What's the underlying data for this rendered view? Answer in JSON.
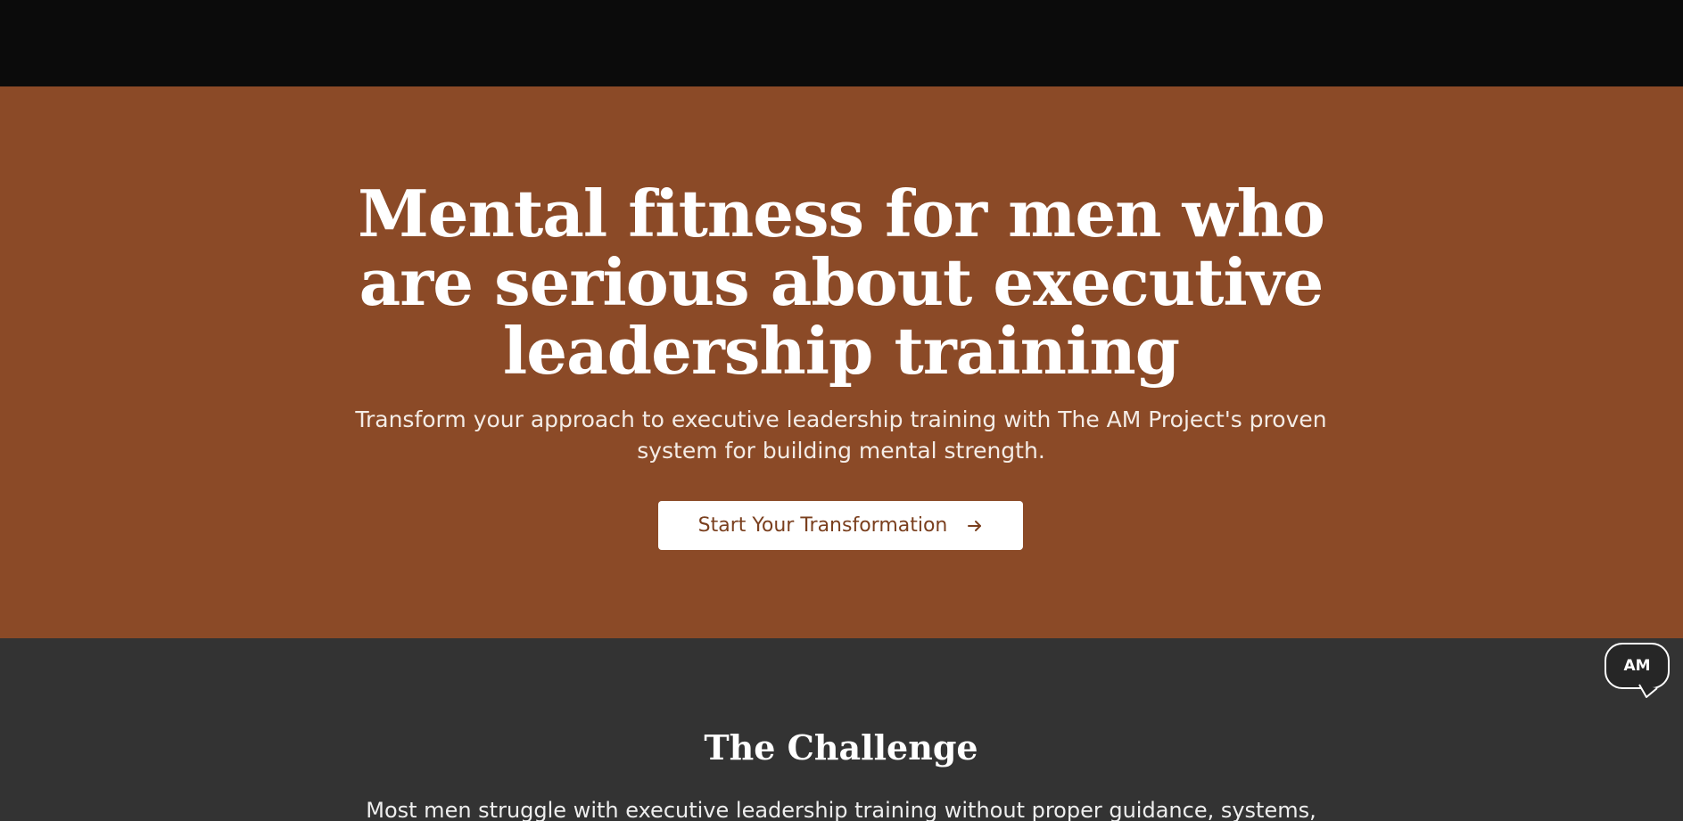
{
  "hero": {
    "title": "Mental fitness for men who are serious about executive leadership training",
    "subtitle": "Transform your approach to executive leadership training with The AM Project's proven system for building mental strength.",
    "cta_label": "Start Your Transformation",
    "cta_icon": "arrow-right-icon"
  },
  "challenge": {
    "title": "The Challenge",
    "text": "Most men struggle with executive leadership training without proper guidance, systems,"
  },
  "chat_widget": {
    "label": "AM"
  },
  "colors": {
    "topbar": "#0b0b0b",
    "hero_background": "#8b4a27",
    "challenge_background": "#333333",
    "cta_background": "#ffffff",
    "cta_text": "#7a3f1e",
    "text_light": "#ffffff"
  }
}
